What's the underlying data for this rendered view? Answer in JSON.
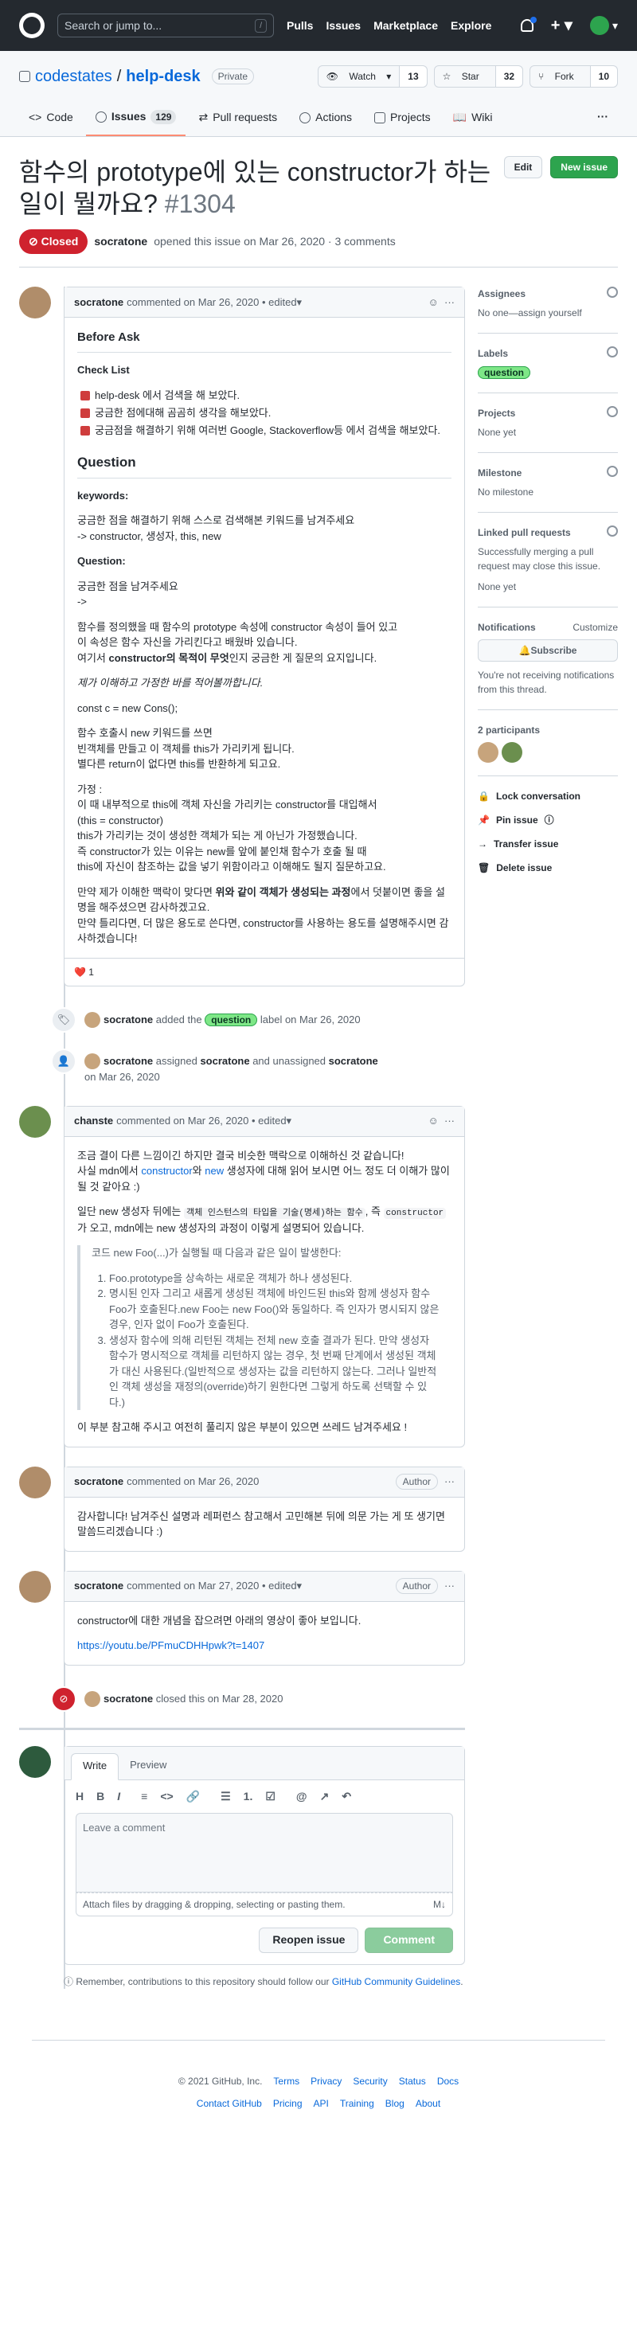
{
  "header": {
    "search_placeholder": "Search or jump to...",
    "search_shortcut": "/",
    "nav": [
      "Pulls",
      "Issues",
      "Marketplace",
      "Explore"
    ]
  },
  "repo": {
    "owner": "codestates",
    "sep": "/",
    "name": "help-desk",
    "visibility": "Private",
    "watch_label": "Watch",
    "watch_count": "13",
    "star_label": "Star",
    "star_count": "32",
    "fork_label": "Fork",
    "fork_count": "10"
  },
  "tabs": [
    {
      "label": "Code"
    },
    {
      "label": "Issues",
      "count": "129"
    },
    {
      "label": "Pull requests"
    },
    {
      "label": "Actions"
    },
    {
      "label": "Projects"
    },
    {
      "label": "Wiki"
    }
  ],
  "more": "···",
  "issue": {
    "title": "함수의 prototype에 있는 constructor가 하는 일이 뭘까요?",
    "number": "#1304",
    "edit_label": "Edit",
    "new_label": "New issue",
    "status": "Closed",
    "author": "socratone",
    "meta": "opened this issue on Mar 26, 2020 · 3 comments"
  },
  "comment1": {
    "author": "socratone",
    "meta": "commented on Mar 26, 2020 • edited",
    "h_before": "Before Ask",
    "h_checklist": "Check List",
    "checks": [
      "help-desk 에서 검색을 해 보았다.",
      "궁금한 점에대해 곰곰히 생각을 해보았다.",
      "궁금점을 해결하기 위해 여러번 Google, Stackoverflow등 에서 검색을 해보았다."
    ],
    "h_question": "Question",
    "h_keywords": "keywords:",
    "kw1": "궁금한 점을 해결하기 위해 스스로 검색해본 키워드를 남겨주세요",
    "kw2": "-> constructor, 생성자, this, new",
    "h_q2": "Question:",
    "q1": "궁금한 점을 남겨주세요",
    "q2": "->",
    "p1a": "함수를 정의했을 때 함수의 prototype 속성에 constructor 속성이 들어 있고",
    "p1b": "이 속성은 함수 자신을 가리킨다고 배웠바 있습니다.",
    "p1c_pre": "여기서 ",
    "p1c_bold": "constructor의 목적이 무엇",
    "p1c_post": "인지 궁금한 게 질문의 요지입니다.",
    "p2": "제가 이해하고 가정한 바를 적어볼까합니다.",
    "p3": "const c = new Cons();",
    "p4a": "함수 호출시 new 키워드를 쓰면",
    "p4b": "빈객체를 만들고 이 객체를 this가 가리키게 됩니다.",
    "p4c": "별다른 return이 없다면 this를 반환하게 되고요.",
    "p5a": "가정 :",
    "p5b": "이 때 내부적으로 this에 객체 자신을 가리키는 constructor를 대입해서",
    "p5c": "(this = constructor)",
    "p5d": "this가 가리키는 것이 생성한 객체가 되는 게 아닌가 가정했습니다.",
    "p5e": "즉 constructor가 있는 이유는 new를 앞에 붙인채 함수가 호출 될 때",
    "p5f": "this에 자신이 참조하는 값을 넣기 위함이라고 이해해도 될지 질문하고요.",
    "p6a_pre": "만약 제가 이해한 맥락이 맞다면 ",
    "p6a_bold": "위와 같이 객체가 생성되는 과정",
    "p6a_post": "에서 덧붙이면 좋을 설명을 해주셨으면 감사하겠고요.",
    "p6b": "만약 틀리다면, 더 많은 용도로 쓴다면, constructor를 사용하는 용도를 설명해주시면 감사하겠습니다!",
    "reaction": "❤️  1"
  },
  "event1": {
    "user": "socratone",
    "pre": "added the",
    "label": "question",
    "post": "label on Mar 26, 2020"
  },
  "event2": {
    "user": "socratone",
    "pre": "assigned",
    "user2": "socratone",
    "mid": "and unassigned",
    "user3": "socratone",
    "post": "on Mar 26, 2020"
  },
  "comment2": {
    "author": "chanste",
    "meta": "commented on Mar 26, 2020 • edited",
    "p1": "조금 결이 다른 느낌이긴 하지만 결국 비슷한 맥락으로 이해하신 것 같습니다!",
    "p2_pre": "사실 mdn에서 ",
    "p2_l1": "constructor",
    "p2_mid": "와 ",
    "p2_l2": "new",
    "p2_post": " 생성자에 대해 읽어 보시면 어느 정도 더 이해가 많이 될 것 같아요 :)",
    "p3_pre": "일단 new 생성자 뒤에는 ",
    "p3_code": "객체 인스턴스의 타입을 기술(명세)하는 함수",
    "p3_mid": ", 즉 ",
    "p3_code2": "constructor",
    "p3_post": " 가 오고, mdn에는 new 생성자의 과정이 이렇게 설명되어 있습니다.",
    "bq": "코드 new Foo(...)가 실행될 때 다음과 같은 일이 발생한다:",
    "ol": [
      "Foo.prototype을 상속하는 새로운 객체가 하나 생성된다.",
      "명시된 인자 그리고 새롭게 생성된 객체에 바인드된 this와 함께 생성자 함수 Foo가 호출된다.new Foo는 new Foo()와 동일하다. 즉 인자가 명시되지 않은 경우, 인자 없이 Foo가 호출된다.",
      "생성자 함수에 의해 리턴된 객체는 전체 new 호출 결과가 된다. 만약 생성자 함수가 명시적으로 객체를 리턴하지 않는 경우, 첫 번째 단계에서 생성된 객체가 대신 사용된다.(일반적으로 생성자는 값을 리턴하지 않는다. 그러나 일반적인 객체 생성을 재정의(override)하기 원한다면 그렇게 하도록 선택할 수 있다.)"
    ],
    "p4": "이 부분 참고해 주시고 여전히 풀리지 않은 부분이 있으면 쓰레드 남겨주세요 !"
  },
  "comment3": {
    "author": "socratone",
    "meta": "commented on Mar 26, 2020",
    "badge": "Author",
    "p1": "감사합니다! 남겨주신 설명과 레퍼런스 참고해서 고민해본 뒤에 의문 가는 게 또 생기면 말씀드리겠습니다 :)"
  },
  "comment4": {
    "author": "socratone",
    "meta": "commented on Mar 27, 2020 • edited",
    "badge": "Author",
    "p1": "constructor에 대한 개념을 잡으려면 아래의 영상이 좋아 보입니다.",
    "link": "https://youtu.be/PFmuCDHHpwk?t=1407"
  },
  "event3": {
    "user": "socratone",
    "post": "closed this on Mar 28, 2020"
  },
  "editor": {
    "tab_write": "Write",
    "tab_preview": "Preview",
    "toolbar": [
      "H",
      "B",
      "I",
      "≡",
      "<>",
      "🔗",
      "☰",
      "1.",
      "☑",
      "@",
      "↗",
      "↶"
    ],
    "placeholder": "Leave a comment",
    "attach": "Attach files by dragging & dropping, selecting or pasting them.",
    "md": "M↓",
    "reopen": "Reopen issue",
    "comment": "Comment",
    "note_pre": "Remember, contributions to this repository should follow our ",
    "note_link": "GitHub Community Guidelines",
    "note_post": "."
  },
  "sidebar": {
    "assignees_h": "Assignees",
    "assignees_v": "No one—assign yourself",
    "labels_h": "Labels",
    "labels_v": "question",
    "projects_h": "Projects",
    "projects_v": "None yet",
    "milestone_h": "Milestone",
    "milestone_v": "No milestone",
    "linked_h": "Linked pull requests",
    "linked_v": "Successfully merging a pull request may close this issue.",
    "linked_v2": "None yet",
    "notif_h": "Notifications",
    "notif_customize": "Customize",
    "subscribe": "Subscribe",
    "notif_v": "You're not receiving notifications from this thread.",
    "participants_h": "2 participants",
    "actions": [
      "Lock conversation",
      "Pin issue",
      "Transfer issue",
      "Delete issue"
    ]
  },
  "footer": {
    "copy": "© 2021 GitHub, Inc.",
    "links1": [
      "Terms",
      "Privacy",
      "Security",
      "Status",
      "Docs"
    ],
    "links2": [
      "Contact GitHub",
      "Pricing",
      "API",
      "Training",
      "Blog",
      "About"
    ]
  }
}
